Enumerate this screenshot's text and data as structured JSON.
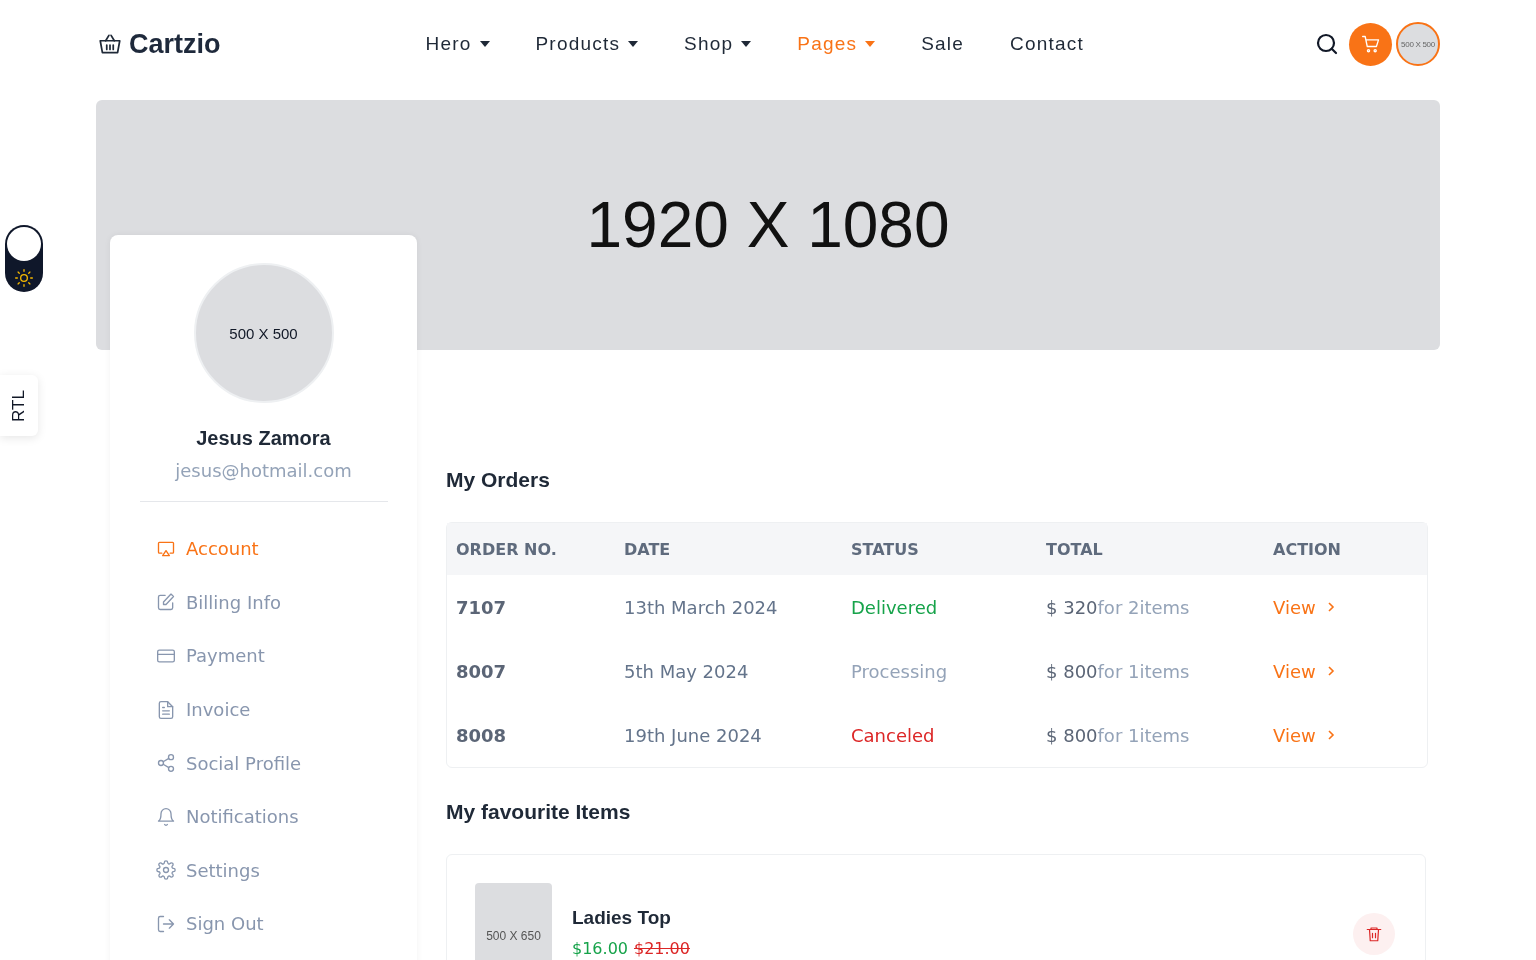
{
  "brand": {
    "name": "Cartzio"
  },
  "nav": [
    {
      "label": "Hero",
      "dropdown": true,
      "selected": false
    },
    {
      "label": "Products",
      "dropdown": true,
      "selected": false
    },
    {
      "label": "Shop",
      "dropdown": true,
      "selected": false
    },
    {
      "label": "Pages",
      "dropdown": true,
      "selected": true
    },
    {
      "label": "Sale",
      "dropdown": false,
      "selected": false
    },
    {
      "label": "Contact",
      "dropdown": false,
      "selected": false
    }
  ],
  "header_avatar": {
    "label": "500 X 500"
  },
  "banner": {
    "label": "1920 X 1080"
  },
  "theme_toggle": {
    "on": false
  },
  "rtl_tab": {
    "label": "RTL"
  },
  "profile": {
    "avatar_label": "500 X 500",
    "name": "Jesus Zamora",
    "email": "jesus@hotmail.com"
  },
  "menu": [
    {
      "label": "Account",
      "selected": true
    },
    {
      "label": "Billing Info",
      "selected": false
    },
    {
      "label": "Payment",
      "selected": false
    },
    {
      "label": "Invoice",
      "selected": false
    },
    {
      "label": "Social Profile",
      "selected": false
    },
    {
      "label": "Notifications",
      "selected": false
    },
    {
      "label": "Settings",
      "selected": false
    },
    {
      "label": "Sign Out",
      "selected": false
    }
  ],
  "orders": {
    "title": "My Orders",
    "columns": [
      "ORDER NO.",
      "DATE",
      "STATUS",
      "TOTAL",
      "ACTION"
    ],
    "rows": [
      {
        "number": "7107",
        "date": "13th March 2024",
        "status": "Delivered",
        "color": "#16a34a",
        "amount": "$ 320",
        "items": "for 2items",
        "action": "View"
      },
      {
        "number": "8007",
        "date": "5th May 2024",
        "status": "Processing",
        "color": "#94a3b8",
        "amount": "$ 800",
        "items": "for 1items",
        "action": "View"
      },
      {
        "number": "8008",
        "date": "19th June 2024",
        "status": "Canceled",
        "color": "#dc2626",
        "amount": "$ 800",
        "items": "for 1items",
        "action": "View"
      }
    ]
  },
  "favourites": {
    "title": "My favourite Items",
    "items": [
      {
        "image_label": "500 X 650",
        "name": "Ladies Top",
        "price": "$16.00",
        "old_price": "$21.00"
      }
    ]
  }
}
